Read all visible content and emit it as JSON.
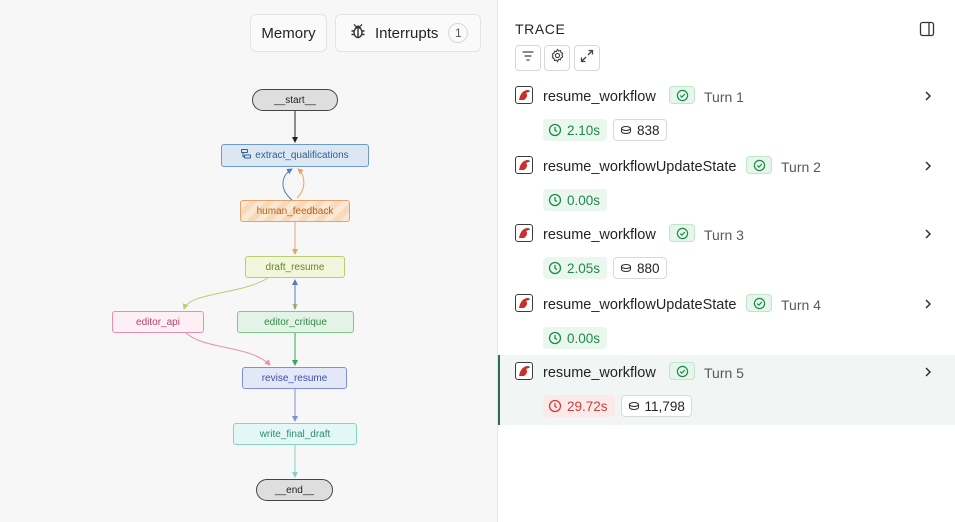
{
  "graph": {
    "memory_label": "Memory",
    "interrupts_label": "Interrupts",
    "interrupts_count": "1",
    "nodes": {
      "start": "__start__",
      "extract": "extract_qualifications",
      "human": "human_feedback",
      "draft": "draft_resume",
      "editor_api": "editor_api",
      "critique": "editor_critique",
      "revise": "revise_resume",
      "write": "write_final_draft",
      "end": "__end__"
    }
  },
  "trace": {
    "title": "TRACE",
    "runs": [
      {
        "name": "resume_workflow",
        "turn": "Turn 1",
        "time": "2.10s",
        "tokens": "838",
        "status": "success"
      },
      {
        "name": "resume_workflowUpdateState",
        "turn": "Turn 2",
        "time": "0.00s",
        "tokens": "",
        "status": "success"
      },
      {
        "name": "resume_workflow",
        "turn": "Turn 3",
        "time": "2.05s",
        "tokens": "880",
        "status": "success"
      },
      {
        "name": "resume_workflowUpdateState",
        "turn": "Turn 4",
        "time": "0.00s",
        "tokens": "",
        "status": "success"
      },
      {
        "name": "resume_workflow",
        "turn": "Turn 5",
        "time": "29.72s",
        "tokens": "11,798",
        "status": "success",
        "selected": true
      }
    ]
  },
  "icons": {
    "bug": "bug-icon",
    "filter": "filter-icon",
    "settings": "gear-icon",
    "expand": "expand-icon",
    "panel": "sidebar-toggle-icon",
    "clock": "clock-icon",
    "tokens": "coins-icon",
    "check": "check-circle-icon",
    "chevron": "chevron-right-icon",
    "app": "parrot-logo-icon"
  },
  "colors": {
    "success": "#1f8a48",
    "slow": "#d43d3d",
    "selected_accent": "#2b6f5a"
  }
}
